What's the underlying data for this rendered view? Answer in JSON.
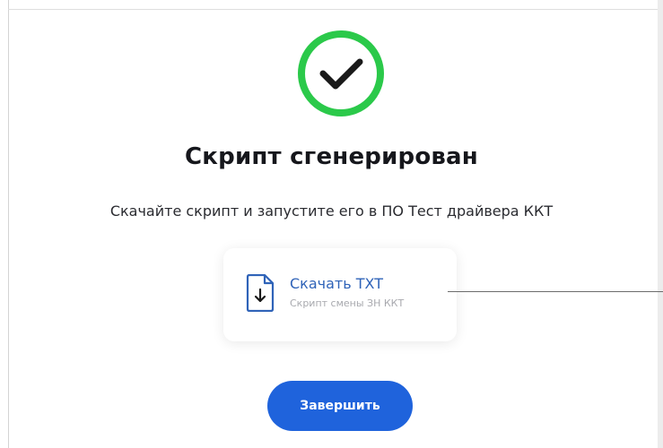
{
  "heading": {
    "title": "Скрипт сгенерирован",
    "subtitle": "Скачайте скрипт и запустите его в ПО Тест драйвера ККТ"
  },
  "icons": {
    "success": "check-circle-icon",
    "file": "file-download-icon"
  },
  "download": {
    "title": "Скачать TXT",
    "description": "Скрипт смены ЗН ККТ"
  },
  "actions": {
    "finish_label": "Завершить"
  },
  "colors": {
    "success_ring": "#2bc94a",
    "primary": "#1f63dc",
    "link": "#2f63b8",
    "title_text": "#16171c",
    "muted_text": "#a8a9ae"
  }
}
